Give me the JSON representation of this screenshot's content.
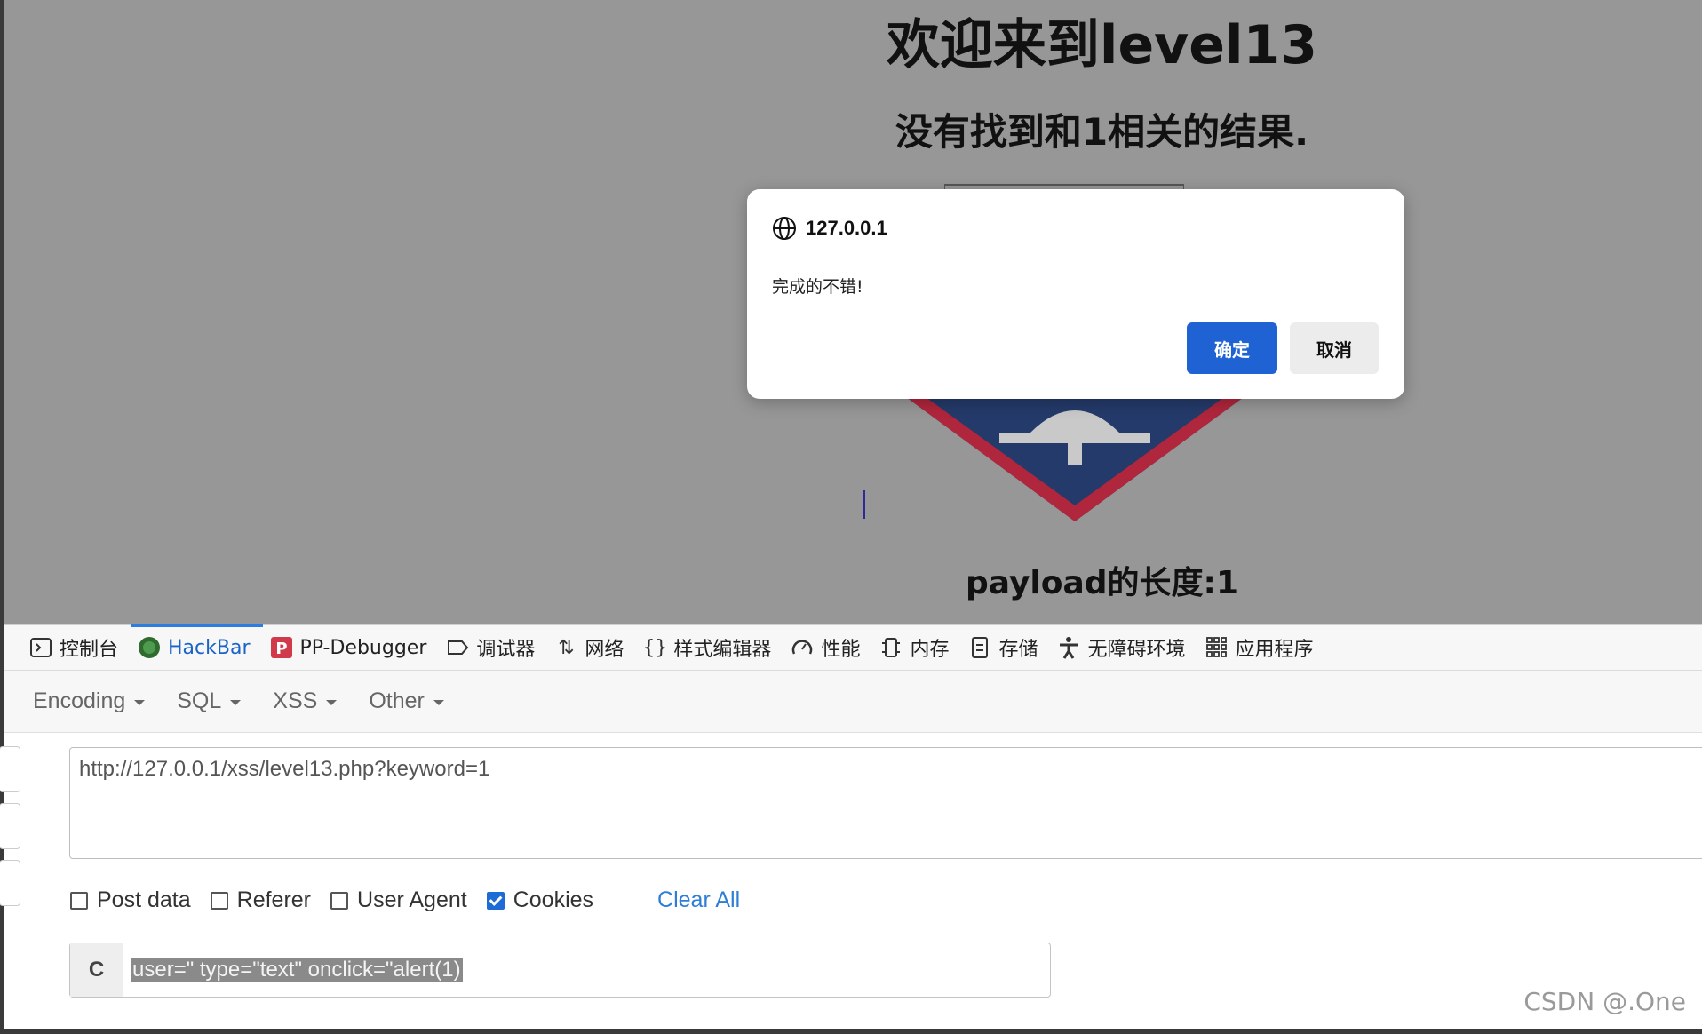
{
  "page": {
    "title": "欢迎来到level13",
    "subtitle": "没有找到和1相关的结果.",
    "payload_length": "payload的长度:1"
  },
  "dialog": {
    "origin": "127.0.0.1",
    "message": "完成的不错!",
    "ok_label": "确定",
    "cancel_label": "取消",
    "ok_color": "#1f62d4"
  },
  "devtools": {
    "tabs": [
      {
        "label": "控制台",
        "icon": "console-icon"
      },
      {
        "label": "HackBar",
        "icon": "hackbar-icon",
        "active": true
      },
      {
        "label": "PP-Debugger",
        "icon": "pp-debugger-icon"
      },
      {
        "label": "调试器",
        "icon": "debugger-icon"
      },
      {
        "label": "网络",
        "icon": "network-icon"
      },
      {
        "label": "样式编辑器",
        "icon": "style-editor-icon"
      },
      {
        "label": "性能",
        "icon": "performance-icon"
      },
      {
        "label": "内存",
        "icon": "memory-icon"
      },
      {
        "label": "存储",
        "icon": "storage-icon"
      },
      {
        "label": "无障碍环境",
        "icon": "accessibility-icon"
      },
      {
        "label": "应用程序",
        "icon": "application-icon"
      }
    ]
  },
  "hackbar": {
    "menus": [
      "Encoding",
      "SQL",
      "XSS",
      "Other"
    ],
    "url": "http://127.0.0.1/xss/level13.php?keyword=1",
    "options": [
      {
        "label": "Post data",
        "checked": false
      },
      {
        "label": "Referer",
        "checked": false
      },
      {
        "label": "User Agent",
        "checked": false
      },
      {
        "label": "Cookies",
        "checked": true
      }
    ],
    "clear_all": "Clear All",
    "cookie_prefix": "C",
    "cookie_value": "user=\" type=\"text\" onclick=\"alert(1)"
  },
  "watermark": "CSDN @.One"
}
